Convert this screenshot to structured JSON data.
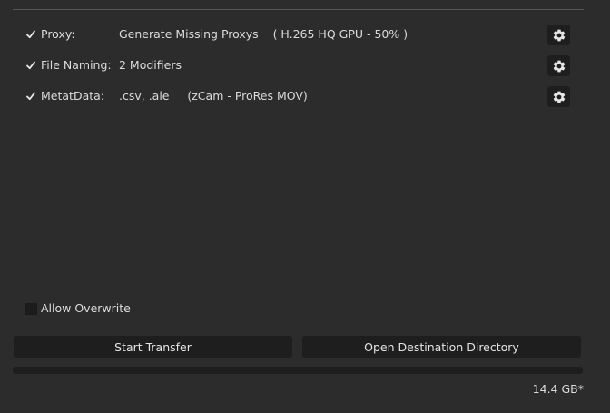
{
  "options": [
    {
      "label": "Proxy:",
      "value": "Generate Missing Proxys    ( H.265 HQ GPU - 50% )",
      "checked": true
    },
    {
      "label": "File Naming:",
      "value": "2 Modifiers",
      "checked": true
    },
    {
      "label": "MetatData:",
      "value": ".csv, .ale     (zCam - ProRes MOV)",
      "checked": true
    }
  ],
  "allow_overwrite": {
    "label": "Allow Overwrite",
    "checked": false
  },
  "buttons": {
    "start_transfer": "Start Transfer",
    "open_destination": "Open Destination Directory"
  },
  "progress": {
    "fraction": 0
  },
  "size_readout": "14.4 GB*",
  "icons": {
    "check": "checkmark-icon",
    "settings": "gear-icon"
  },
  "colors": {
    "background": "#2c2c2c",
    "control": "#1e1e1e",
    "text": "#dcdcdc"
  }
}
